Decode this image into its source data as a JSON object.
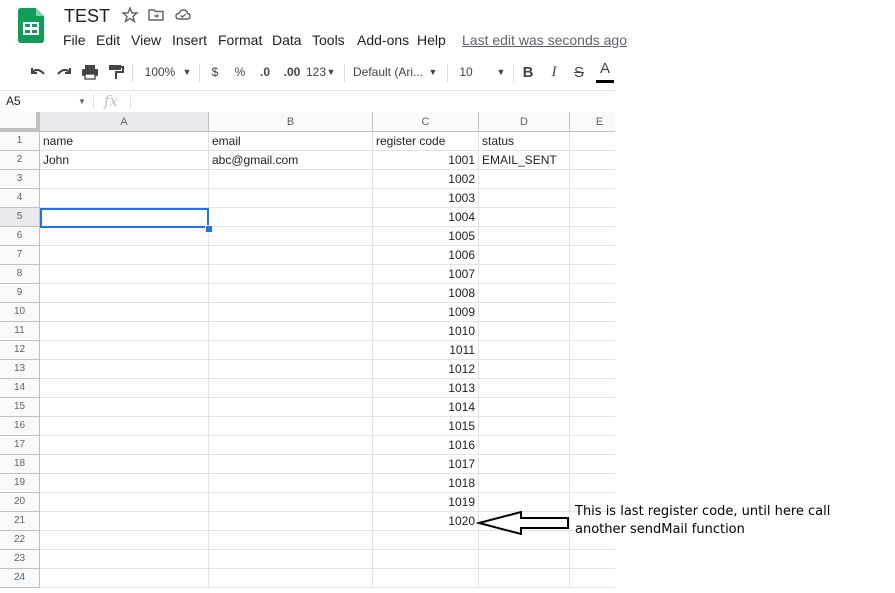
{
  "header": {
    "title": "TEST",
    "menu": [
      "File",
      "Edit",
      "View",
      "Insert",
      "Format",
      "Data",
      "Tools",
      "Add-ons",
      "Help"
    ],
    "last_edit": "Last edit was seconds ago"
  },
  "toolbar": {
    "zoom": "100%",
    "currency": "$",
    "percent": "%",
    "decrease_decimal": ".0",
    "increase_decimal": ".00",
    "number_format": "123",
    "font": "Default (Ari...",
    "font_size": "10",
    "bold": "B",
    "italic": "I",
    "strikethrough": "S",
    "text_color": "A"
  },
  "formula_bar": {
    "name_box": "A5",
    "fx": "fx",
    "value": ""
  },
  "grid": {
    "columns": [
      "A",
      "B",
      "C",
      "D",
      "E"
    ],
    "rows": [
      {
        "n": "1",
        "a": "name",
        "b": "email",
        "c": "register code",
        "d": "status"
      },
      {
        "n": "2",
        "a": "John",
        "b": "abc@gmail.com",
        "c": "1001",
        "d": "EMAIL_SENT"
      },
      {
        "n": "3",
        "a": "",
        "b": "",
        "c": "1002",
        "d": ""
      },
      {
        "n": "4",
        "a": "",
        "b": "",
        "c": "1003",
        "d": ""
      },
      {
        "n": "5",
        "a": "",
        "b": "",
        "c": "1004",
        "d": ""
      },
      {
        "n": "6",
        "a": "",
        "b": "",
        "c": "1005",
        "d": ""
      },
      {
        "n": "7",
        "a": "",
        "b": "",
        "c": "1006",
        "d": ""
      },
      {
        "n": "8",
        "a": "",
        "b": "",
        "c": "1007",
        "d": ""
      },
      {
        "n": "9",
        "a": "",
        "b": "",
        "c": "1008",
        "d": ""
      },
      {
        "n": "10",
        "a": "",
        "b": "",
        "c": "1009",
        "d": ""
      },
      {
        "n": "11",
        "a": "",
        "b": "",
        "c": "1010",
        "d": ""
      },
      {
        "n": "12",
        "a": "",
        "b": "",
        "c": "1011",
        "d": ""
      },
      {
        "n": "13",
        "a": "",
        "b": "",
        "c": "1012",
        "d": ""
      },
      {
        "n": "14",
        "a": "",
        "b": "",
        "c": "1013",
        "d": ""
      },
      {
        "n": "15",
        "a": "",
        "b": "",
        "c": "1014",
        "d": ""
      },
      {
        "n": "16",
        "a": "",
        "b": "",
        "c": "1015",
        "d": ""
      },
      {
        "n": "17",
        "a": "",
        "b": "",
        "c": "1016",
        "d": ""
      },
      {
        "n": "18",
        "a": "",
        "b": "",
        "c": "1017",
        "d": ""
      },
      {
        "n": "19",
        "a": "",
        "b": "",
        "c": "1018",
        "d": ""
      },
      {
        "n": "20",
        "a": "",
        "b": "",
        "c": "1019",
        "d": ""
      },
      {
        "n": "21",
        "a": "",
        "b": "",
        "c": "1020",
        "d": ""
      },
      {
        "n": "22",
        "a": "",
        "b": "",
        "c": "",
        "d": ""
      },
      {
        "n": "23",
        "a": "",
        "b": "",
        "c": "",
        "d": ""
      },
      {
        "n": "24",
        "a": "",
        "b": "",
        "c": "",
        "d": ""
      }
    ],
    "selected_cell": "A5"
  },
  "annotation": {
    "line1": "This is last register code, until here call",
    "line2": "another sendMail function"
  },
  "colors": {
    "accent": "#1a73e8",
    "sheets_green": "#0f9d58"
  }
}
